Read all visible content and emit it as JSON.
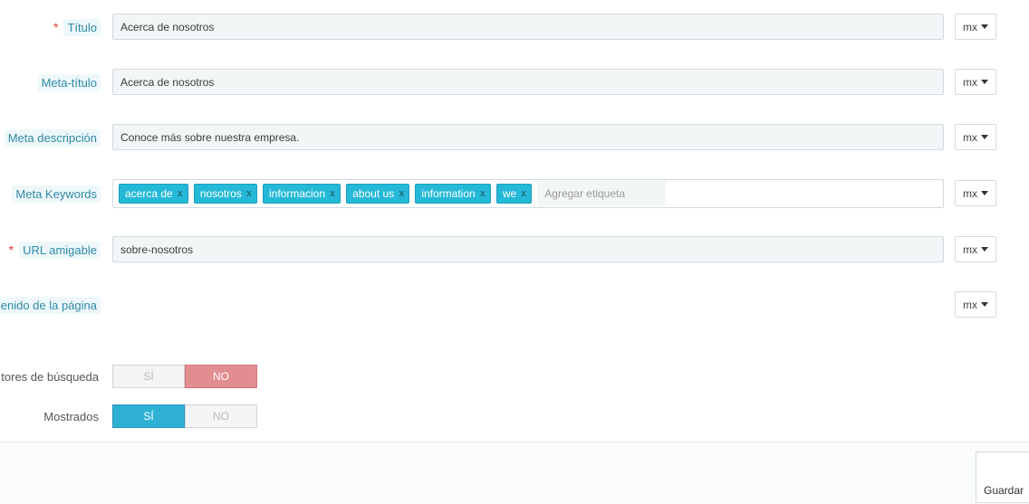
{
  "fields": {
    "title": {
      "label": "Título",
      "required": "*",
      "value": "Acerca de nosotros",
      "lang": "mx"
    },
    "meta_title": {
      "label": "Meta-título",
      "value": "Acerca de nosotros",
      "lang": "mx"
    },
    "meta_description": {
      "label": "Meta descripción",
      "value": "Conoce más sobre nuestra empresa.",
      "lang": "mx"
    },
    "meta_keywords": {
      "label": "Meta Keywords",
      "tags": [
        "acerca de",
        "nosotros",
        "informacion",
        "about us",
        "information",
        "we"
      ],
      "remove_glyph": "x",
      "placeholder": "Agregar etiqueta",
      "lang": "mx"
    },
    "friendly_url": {
      "label": "URL amigable",
      "required": "*",
      "value": "sobre-nosotros",
      "lang": "mx"
    },
    "page_content": {
      "label": "enido de la página",
      "lang": "mx"
    },
    "search_engines": {
      "label": "tores de búsqueda",
      "yes": "SÍ",
      "no": "NO",
      "selected": "NO"
    },
    "displayed": {
      "label": "Mostrados",
      "yes": "SÍ",
      "no": "NO",
      "selected": "SÍ"
    }
  },
  "footer": {
    "save_label": "Guardar"
  },
  "colors": {
    "accent": "#25b9d7",
    "danger": "#e28d90",
    "required": "#e53935"
  }
}
